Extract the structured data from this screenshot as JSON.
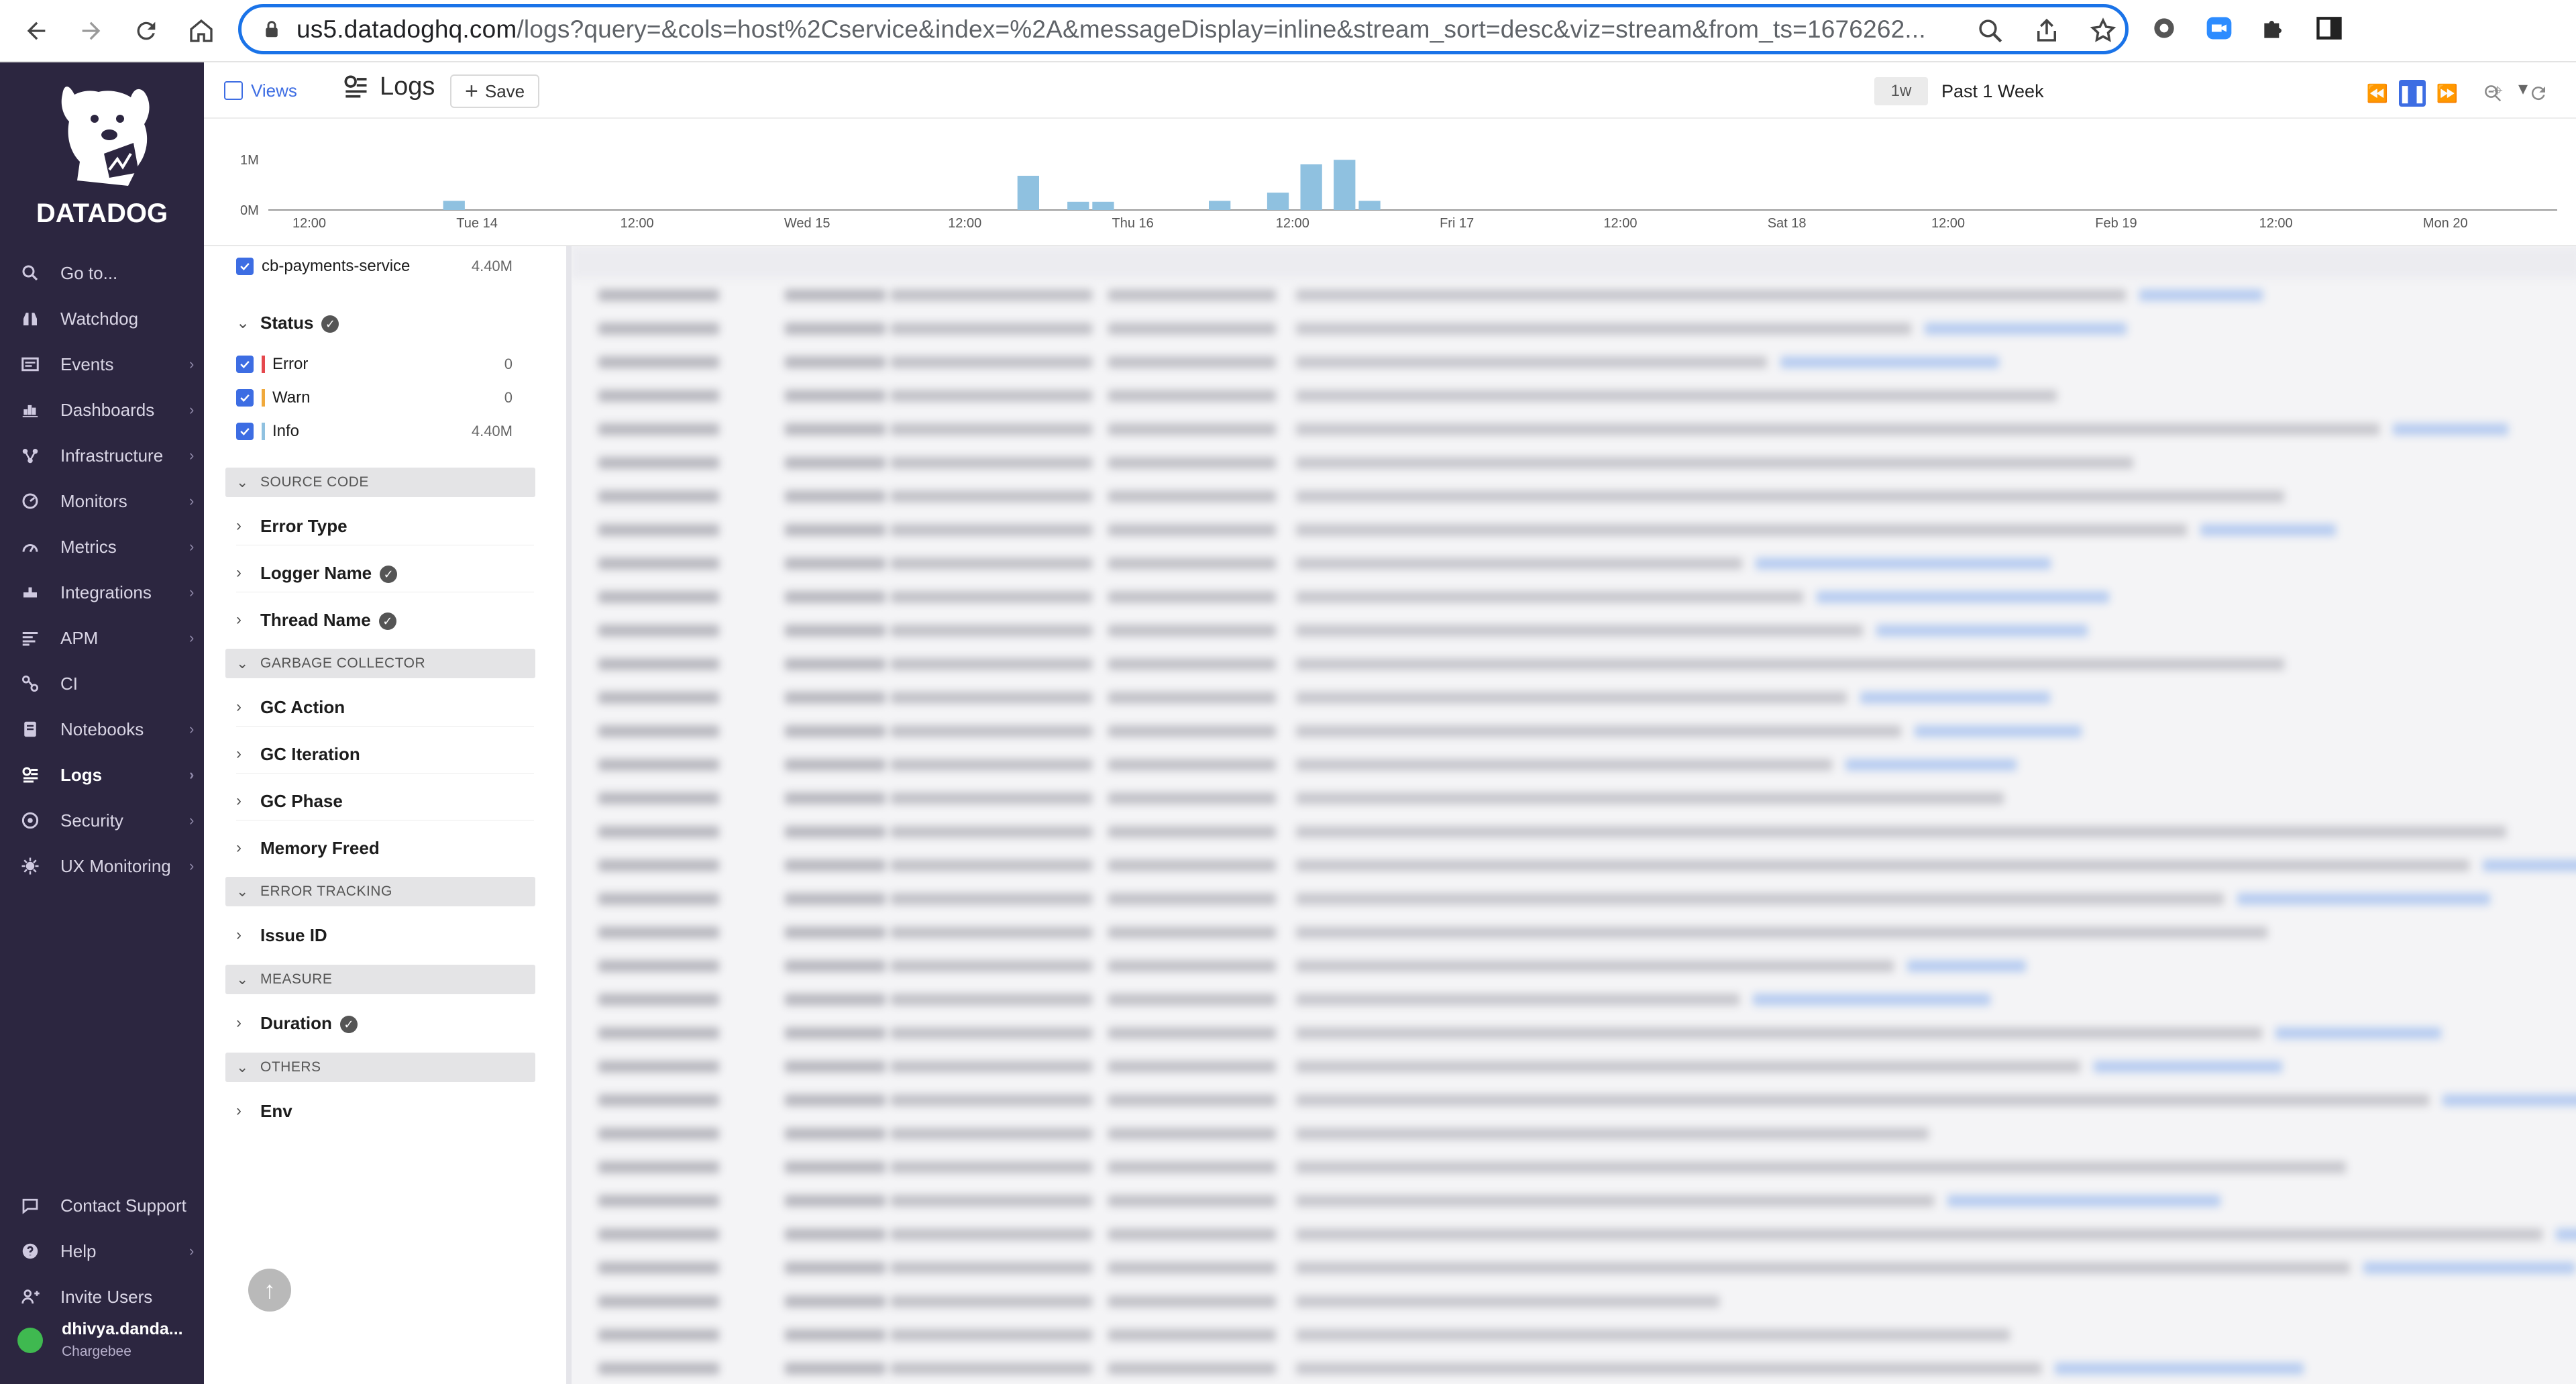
{
  "browser": {
    "url_host": "us5.datadoghq.com",
    "url_rest": "/logs?query=&cols=host%2Cservice&index=%2A&messageDisplay=inline&stream_sort=desc&viz=stream&from_ts=1676262...",
    "icons": [
      "back-icon",
      "forward-icon",
      "reload-icon",
      "home-icon",
      "lock-icon",
      "zoom-icon",
      "share-icon",
      "star-icon",
      "extension-gear-icon",
      "extension-zoom-icon",
      "puzzle-icon",
      "sidepanel-icon"
    ]
  },
  "sidebar": {
    "brand": "DATADOG",
    "items": [
      {
        "label": "Go to...",
        "icon": "search-icon"
      },
      {
        "label": "Watchdog",
        "icon": "binoculars-icon"
      },
      {
        "label": "Events",
        "icon": "events-icon"
      },
      {
        "label": "Dashboards",
        "icon": "dashboards-icon"
      },
      {
        "label": "Infrastructure",
        "icon": "infrastructure-icon"
      },
      {
        "label": "Monitors",
        "icon": "monitors-icon"
      },
      {
        "label": "Metrics",
        "icon": "metrics-icon"
      },
      {
        "label": "Integrations",
        "icon": "integrations-icon"
      },
      {
        "label": "APM",
        "icon": "apm-icon"
      },
      {
        "label": "CI",
        "icon": "ci-icon"
      },
      {
        "label": "Notebooks",
        "icon": "notebooks-icon"
      },
      {
        "label": "Logs",
        "icon": "logs-icon"
      },
      {
        "label": "Security",
        "icon": "security-icon"
      },
      {
        "label": "UX Monitoring",
        "icon": "ux-monitoring-icon"
      }
    ],
    "bottom_items": [
      {
        "label": "Contact Support",
        "icon": "support-icon"
      },
      {
        "label": "Help",
        "icon": "help-icon"
      },
      {
        "label": "Invite Users",
        "icon": "invite-icon"
      }
    ],
    "user": {
      "name": "dhivya.danda...",
      "org": "Chargebee"
    }
  },
  "toolbar": {
    "views_label": "Views",
    "title": "Logs",
    "save_label": "Save",
    "time_badge": "1w",
    "time_range": "Past 1 Week"
  },
  "histogram": {
    "y_ticks": [
      "1M",
      "0M"
    ],
    "x_ticks": [
      "12:00",
      "Tue 14",
      "12:00",
      "Wed 15",
      "12:00",
      "Thu 16",
      "12:00",
      "Fri 17",
      "12:00",
      "Sat 18",
      "12:00",
      "Feb 19",
      "12:00",
      "Mon 20"
    ],
    "bar_color": "#8fc1e0",
    "bars": [
      {
        "slot": 21,
        "value": 0.2
      },
      {
        "slot": 90,
        "value": 0.75
      },
      {
        "slot": 96,
        "value": 0.18
      },
      {
        "slot": 99,
        "value": 0.18
      },
      {
        "slot": 113,
        "value": 0.2
      },
      {
        "slot": 120,
        "value": 0.38
      },
      {
        "slot": 124,
        "value": 1.0
      },
      {
        "slot": 128,
        "value": 1.1
      },
      {
        "slot": 131,
        "value": 0.2
      }
    ],
    "slots_total": 275
  },
  "facets": {
    "service_value": {
      "label": "cb-payments-service",
      "count": "4.40M"
    },
    "status": {
      "title": "Status",
      "values": [
        {
          "label": "Error",
          "count": "0",
          "color": "#e5484d"
        },
        {
          "label": "Warn",
          "count": "0",
          "color": "#f0a93b"
        },
        {
          "label": "Info",
          "count": "4.40M",
          "color": "#8fc1e0"
        }
      ]
    },
    "groups": [
      {
        "title": "SOURCE CODE",
        "facets": [
          {
            "label": "Error Type",
            "verified": false
          },
          {
            "label": "Logger Name",
            "verified": true
          },
          {
            "label": "Thread Name",
            "verified": true
          }
        ]
      },
      {
        "title": "GARBAGE COLLECTOR",
        "facets": [
          {
            "label": "GC Action",
            "verified": false
          },
          {
            "label": "GC Iteration",
            "verified": false
          },
          {
            "label": "GC Phase",
            "verified": false
          },
          {
            "label": "Memory Freed",
            "verified": false
          }
        ]
      },
      {
        "title": "ERROR TRACKING",
        "facets": [
          {
            "label": "Issue ID",
            "verified": false
          }
        ]
      },
      {
        "title": "MEASURE",
        "facets": [
          {
            "label": "Duration",
            "verified": true
          }
        ]
      },
      {
        "title": "OTHERS",
        "facets": [
          {
            "label": "Env",
            "verified": false
          }
        ]
      }
    ]
  }
}
